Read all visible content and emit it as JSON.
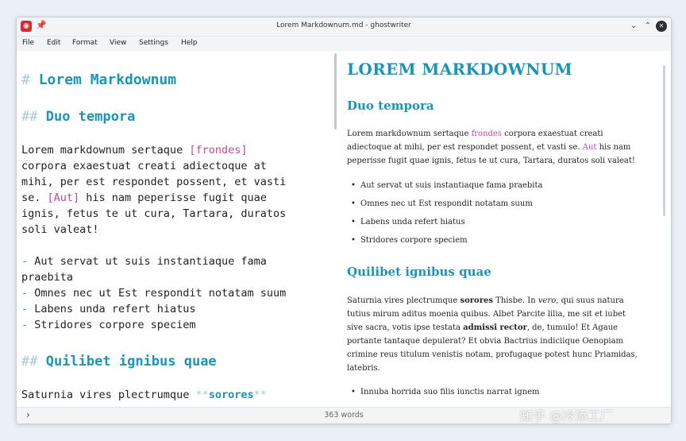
{
  "window": {
    "title": "Lorem Markdownum.md - ghostwriter"
  },
  "titlebar": {
    "app_icon": "ghostwriter-icon",
    "pin": "📌",
    "minimize": "⌄",
    "maximize": "⌃",
    "close": "✕"
  },
  "menubar": {
    "items": [
      "File",
      "Edit",
      "Format",
      "View",
      "Settings",
      "Help"
    ]
  },
  "editor": {
    "h1_hash": "#",
    "h1_text": "Lorem Markdownum",
    "h2a_hash": "##",
    "h2a_text": "Duo tempora",
    "p1": [
      {
        "pre": "Lorem markdownum sertaque ",
        "link": "[frondes]",
        "post": ""
      },
      {
        "pre": "corpora exaestuat creati adiectoque at",
        "link": "",
        "post": ""
      },
      {
        "pre": "mihi, per est respondet possent, et vasti",
        "link": "",
        "post": ""
      },
      {
        "pre": "se. ",
        "link": "[Aut]",
        "post": " his nam peperisse fugit quae"
      },
      {
        "pre": "ignis, fetus te ut cura, Tartara, duratos",
        "link": "",
        "post": ""
      },
      {
        "pre": "soli valeat!",
        "link": "",
        "post": ""
      }
    ],
    "bullet_mark": "-",
    "bullets": [
      "Aut servat ut suis instantiaque fama",
      "Omnes nec ut Est respondit notatam suum",
      "Labens unda refert hiatus",
      "Stridores corpore speciem"
    ],
    "bullet1_cont": "praebita",
    "h2b_hash": "##",
    "h2b_text": "Quilibet ignibus quae",
    "p2_pre": "Saturnia vires plectrumque ",
    "p2_mark": "**",
    "p2_bold": "sorores"
  },
  "preview": {
    "h1": "LOREM MARKDOWNUM",
    "h2a": "Duo tempora",
    "p1": [
      {
        "pre": "Lorem markdownum sertaque ",
        "link": "frondes",
        "post": " corpora exaestuat creati"
      },
      {
        "pre": "adiectoque at mihi, per est respondet possent, et vasti se. ",
        "link": "Aut",
        "post": " his nam"
      },
      {
        "pre": "peperisse fugit quae ignis, fetus te ut cura, Tartara, duratos soli valeat!",
        "link": "",
        "post": ""
      }
    ],
    "bullets": [
      "Aut servat ut suis instantiaque fama praebita",
      "Omnes nec ut Est respondit notatam suum",
      "Labens unda refert hiatus",
      "Stridores corpore speciem"
    ],
    "h2b": "Quilibet ignibus quae",
    "p2_l1_a": "Saturnia vires plectrumque ",
    "p2_l1_b": "sorores",
    "p2_l1_c": " Thisbe. In ",
    "p2_l1_d": "vero,",
    "p2_l1_e": " qui suus natura",
    "p2_l2": "tutius mirum aditus moenia quibus. Albet Parcite lilia, me sit et iubet",
    "p2_l3_a": "sive sacra, votis ipse testata ",
    "p2_l3_b": "admissi rector",
    "p2_l3_c": ", de, tumulo! Et Agaue",
    "p2_l4": "portante tantaque depulerat? Et obvia Bactrius indiciique Oenopiam",
    "p2_l5": "crimine reus titulum venistis notam, profugaque potest hunc Priamidas,",
    "p2_l6": "latebris.",
    "bullet_last": "Innuba horrida suo filis iunctis narrat ignem"
  },
  "statusbar": {
    "expand": "›",
    "word_count": "363 words"
  },
  "watermark": "知乎 @冷添工厂"
}
